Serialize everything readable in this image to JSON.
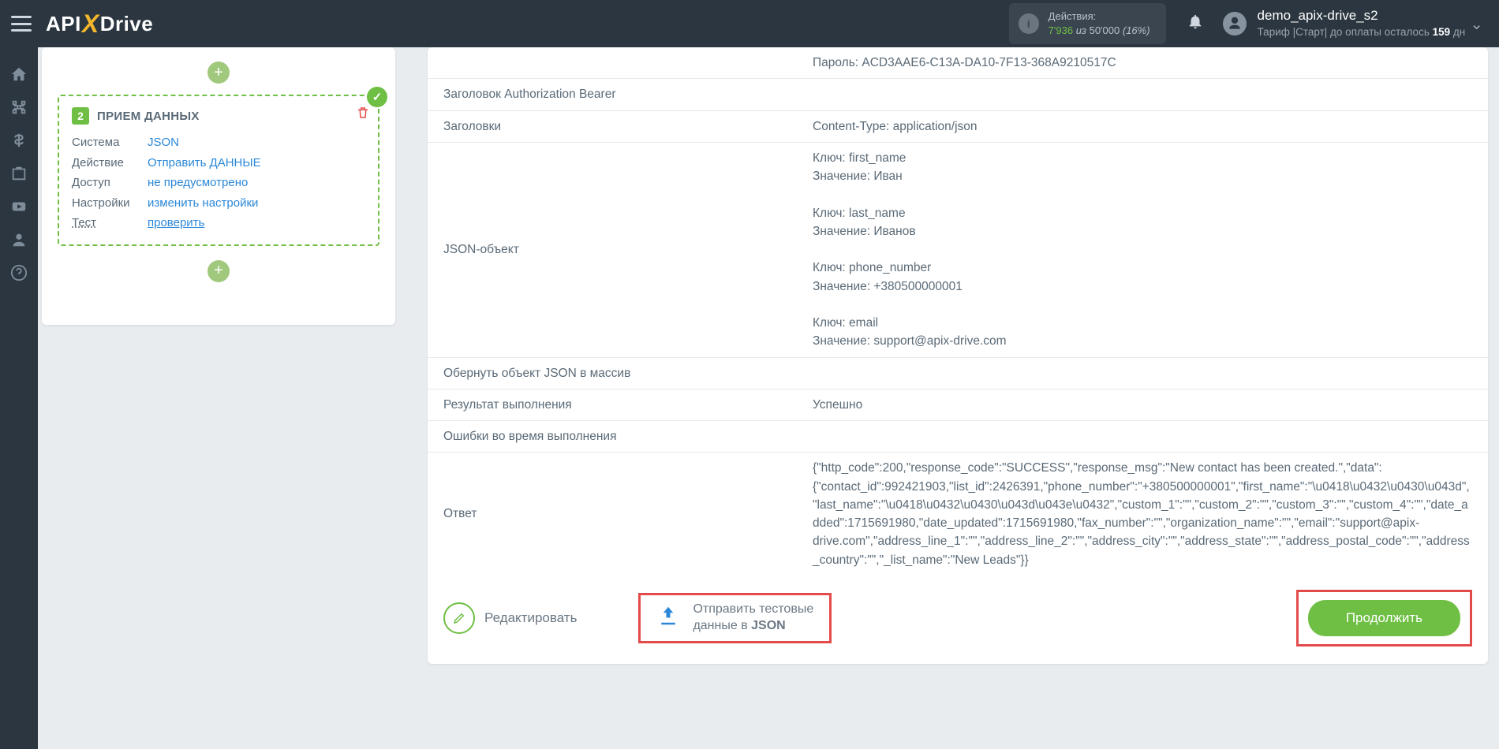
{
  "header": {
    "logo_api": "API",
    "logo_drive": "Drive",
    "actions_label": "Действия:",
    "actions_used": "7'936",
    "actions_of": "из",
    "actions_total": "50'000",
    "actions_pct": "(16%)",
    "user_name": "demo_apix-drive_s2",
    "plan_prefix": "Тариф |Старт| до оплаты осталось ",
    "plan_days": "159",
    "plan_suffix": " дн"
  },
  "sidebar_btn_add": "+",
  "step": {
    "num": "2",
    "title": "ПРИЕМ ДАННЫХ",
    "rows": [
      {
        "k": "Система",
        "v": "JSON",
        "ku": false,
        "vu": false
      },
      {
        "k": "Действие",
        "v": "Отправить ДАННЫЕ",
        "ku": false,
        "vu": false
      },
      {
        "k": "Доступ",
        "v": "не предусмотрено",
        "ku": false,
        "vu": false
      },
      {
        "k": "Настройки",
        "v": "изменить настройки",
        "ku": false,
        "vu": false
      },
      {
        "k": "Тест",
        "v": "проверить",
        "ku": true,
        "vu": true
      }
    ]
  },
  "table": [
    {
      "l": "",
      "r": "Пароль: ACD3AAE6-C13A-DA10-7F13-368A9210517C"
    },
    {
      "l": "Заголовок Authorization Bearer",
      "r": ""
    },
    {
      "l": "Заголовки",
      "r": "Content-Type: application/json"
    },
    {
      "l": "JSON-объект",
      "r": "Ключ: first_name\nЗначение: Иван\n\nКлюч: last_name\nЗначение: Иванов\n\nКлюч: phone_number\nЗначение: +380500000001\n\nКлюч: email\nЗначение: support@apix-drive.com"
    },
    {
      "l": "Обернуть объект JSON в массив",
      "r": ""
    },
    {
      "l": "Результат выполнения",
      "r": "Успешно"
    },
    {
      "l": "Ошибки во время выполнения",
      "r": ""
    },
    {
      "l": "Ответ",
      "r": "{\"http_code\":200,\"response_code\":\"SUCCESS\",\"response_msg\":\"New contact has been created.\",\"data\":{\"contact_id\":992421903,\"list_id\":2426391,\"phone_number\":\"+380500000001\",\"first_name\":\"\\u0418\\u0432\\u0430\\u043d\",\"last_name\":\"\\u0418\\u0432\\u0430\\u043d\\u043e\\u0432\",\"custom_1\":\"\",\"custom_2\":\"\",\"custom_3\":\"\",\"custom_4\":\"\",\"date_added\":1715691980,\"date_updated\":1715691980,\"fax_number\":\"\",\"organization_name\":\"\",\"email\":\"support@apix-drive.com\",\"address_line_1\":\"\",\"address_line_2\":\"\",\"address_city\":\"\",\"address_state\":\"\",\"address_postal_code\":\"\",\"address_country\":\"\",\"_list_name\":\"New Leads\"}}"
    }
  ],
  "buttons": {
    "edit": "Редактировать",
    "send_l1": "Отправить тестовые",
    "send_l2_pre": "данные в ",
    "send_l2_b": "JSON",
    "continue": "Продолжить"
  }
}
